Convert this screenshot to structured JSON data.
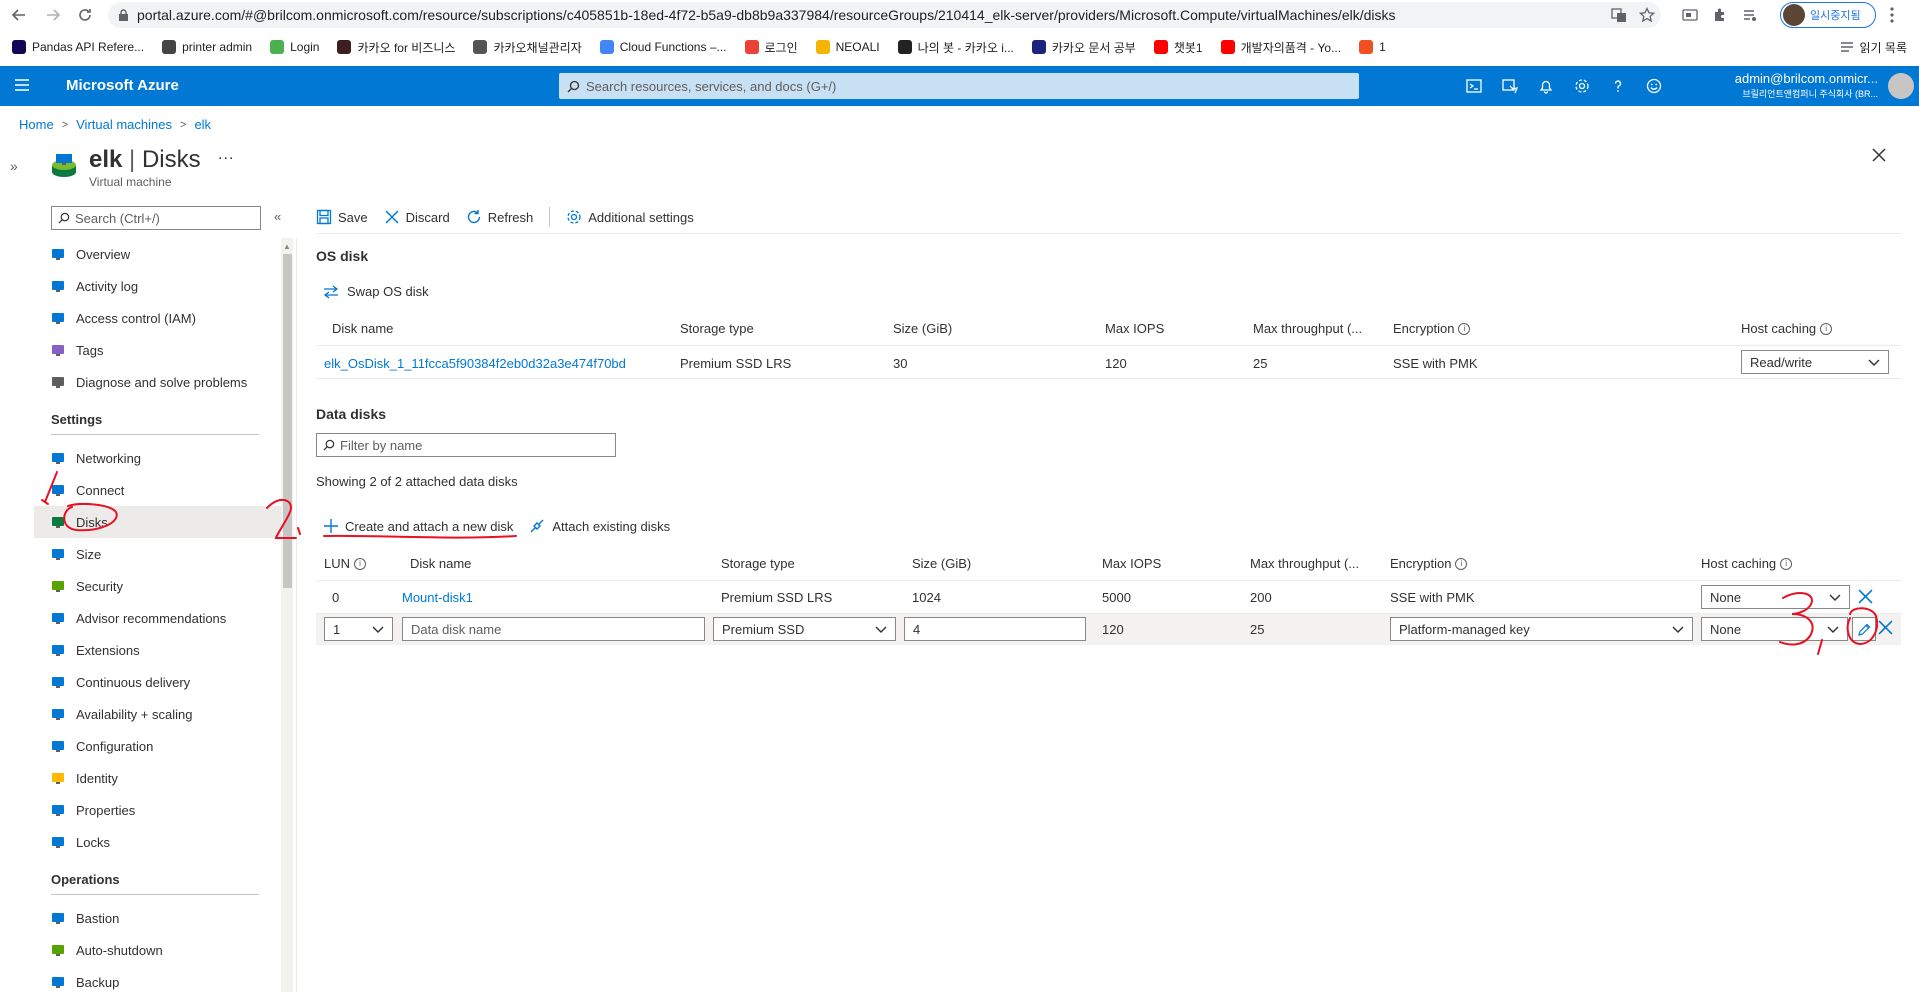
{
  "browser": {
    "url": "portal.azure.com/#@brilcom.onmicrosoft.com/resource/subscriptions/c405851b-18ed-4f72-b5a9-db8b9a337984/resourceGroups/210414_elk-server/providers/Microsoft.Compute/virtualMachines/elk/disks",
    "profile_label": "일시중지됨",
    "bookmarks": [
      {
        "label": "Pandas API Refere...",
        "color": "#130754"
      },
      {
        "label": "printer admin",
        "color": "#444444"
      },
      {
        "label": "Login",
        "color": "#4caf50"
      },
      {
        "label": "카카오 for 비즈니스",
        "color": "#3c1e1e"
      },
      {
        "label": "카카오채널관리자",
        "color": "#555555"
      },
      {
        "label": "Cloud Functions –...",
        "color": "#4285f4"
      },
      {
        "label": "로그인",
        "color": "#ea4335"
      },
      {
        "label": "NEOALI",
        "color": "#f4b400"
      },
      {
        "label": "나의 봇 - 카카오 i...",
        "color": "#222222"
      },
      {
        "label": "카카오 문서 공부",
        "color": "#1a237e"
      },
      {
        "label": "챗봇1",
        "color": "#ff0000"
      },
      {
        "label": "개발자의품격 - Yo...",
        "color": "#ff0000"
      },
      {
        "label": "1",
        "color": "#f25022"
      }
    ],
    "reading_list": "읽기 목록"
  },
  "azure": {
    "brand": "Microsoft Azure",
    "search_placeholder": "Search resources, services, and docs (G+/)",
    "account_email": "admin@brilcom.onmicr...",
    "account_org": "브릴리언트앤컴퍼니 주식회사 (BR..."
  },
  "breadcrumb": [
    "Home",
    "Virtual machines",
    "elk"
  ],
  "resource": {
    "name": "elk",
    "blade": "Disks",
    "separator": "|",
    "type": "Virtual machine",
    "more": "..."
  },
  "leftnav": {
    "search_placeholder": "Search (Ctrl+/)",
    "collapse": "«",
    "top_items": [
      {
        "label": "Overview",
        "icon": "monitor-icon"
      },
      {
        "label": "Activity log",
        "icon": "log-icon"
      },
      {
        "label": "Access control (IAM)",
        "icon": "people-icon"
      },
      {
        "label": "Tags",
        "icon": "tag-icon"
      },
      {
        "label": "Diagnose and solve problems",
        "icon": "wrench-icon"
      }
    ],
    "settings_title": "Settings",
    "settings_items": [
      {
        "label": "Networking",
        "icon": "network-icon"
      },
      {
        "label": "Connect",
        "icon": "plug-icon"
      },
      {
        "label": "Disks",
        "icon": "disk-icon",
        "active": true
      },
      {
        "label": "Size",
        "icon": "monitor-icon"
      },
      {
        "label": "Security",
        "icon": "shield-icon"
      },
      {
        "label": "Advisor recommendations",
        "icon": "cloud-icon"
      },
      {
        "label": "Extensions",
        "icon": "extension-icon"
      },
      {
        "label": "Continuous delivery",
        "icon": "delivery-icon"
      },
      {
        "label": "Availability + scaling",
        "icon": "scale-icon"
      },
      {
        "label": "Configuration",
        "icon": "config-icon"
      },
      {
        "label": "Identity",
        "icon": "key-icon"
      },
      {
        "label": "Properties",
        "icon": "properties-icon"
      },
      {
        "label": "Locks",
        "icon": "lock-icon"
      }
    ],
    "operations_title": "Operations",
    "operations_items": [
      {
        "label": "Bastion",
        "icon": "bastion-icon"
      },
      {
        "label": "Auto-shutdown",
        "icon": "clock-icon"
      },
      {
        "label": "Backup",
        "icon": "backup-icon"
      }
    ]
  },
  "toolbar": {
    "save": "Save",
    "discard": "Discard",
    "refresh": "Refresh",
    "additional_settings": "Additional settings"
  },
  "os_disk": {
    "title": "OS disk",
    "swap": "Swap OS disk",
    "columns": [
      "Disk name",
      "Storage type",
      "Size (GiB)",
      "Max IOPS",
      "Max throughput (...",
      "Encryption",
      "Host caching"
    ],
    "row": {
      "name": "elk_OsDisk_1_11fcca5f90384f2eb0d32a3e474f70bd",
      "storage": "Premium SSD LRS",
      "size": "30",
      "iops": "120",
      "throughput": "25",
      "encryption": "SSE with PMK",
      "caching": "Read/write"
    }
  },
  "data_disks": {
    "title": "Data disks",
    "filter_placeholder": "Filter by name",
    "showing": "Showing 2 of 2 attached data disks",
    "create_new": "Create and attach a new disk",
    "attach_existing": "Attach existing disks",
    "columns": [
      "LUN",
      "Disk name",
      "Storage type",
      "Size (GiB)",
      "Max IOPS",
      "Max throughput (...",
      "Encryption",
      "Host caching"
    ],
    "row1": {
      "lun": "0",
      "name": "Mount-disk1",
      "storage": "Premium SSD LRS",
      "size": "1024",
      "iops": "5000",
      "throughput": "200",
      "encryption": "SSE with PMK",
      "caching": "None"
    },
    "row2": {
      "lun": "1",
      "name_placeholder": "Data disk name",
      "storage": "Premium SSD",
      "size": "4",
      "iops": "120",
      "throughput": "25",
      "encryption": "Platform-managed key",
      "caching": "None"
    }
  },
  "colors": {
    "azure_blue": "#0078d4",
    "annotation_red": "#e81123"
  }
}
